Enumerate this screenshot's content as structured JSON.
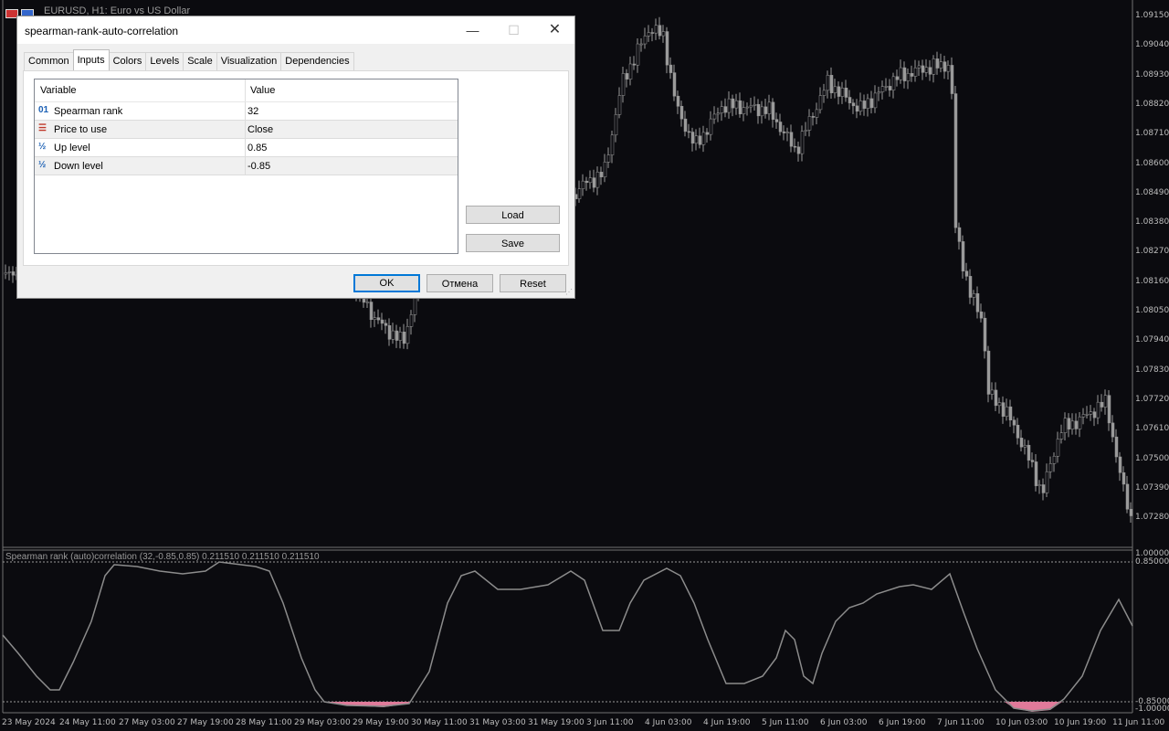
{
  "chart": {
    "title": "EURUSD, H1:  Euro vs US Dollar",
    "indicator_title": "Spearman rank (auto)correlation (32,-0.85,0.85) 0.211510 0.211510 0.211510",
    "price_labels": [
      "1.09150",
      "1.09040",
      "1.08930",
      "1.08820",
      "1.08710",
      "1.08600",
      "1.08490",
      "1.08380",
      "1.08270",
      "1.08160",
      "1.08050",
      "1.07940",
      "1.07830",
      "1.07720",
      "1.07610",
      "1.07500",
      "1.07390",
      "1.07280"
    ],
    "indicator_labels": [
      "1.000000",
      "0.850000",
      "-0.85000",
      "-1.00000"
    ],
    "time_labels": [
      "23 May 2024",
      "24 May 11:00",
      "27 May 03:00",
      "27 May 19:00",
      "28 May 11:00",
      "29 May 03:00",
      "29 May 19:00",
      "30 May 11:00",
      "31 May 03:00",
      "31 May 19:00",
      "3 Jun 11:00",
      "4 Jun 03:00",
      "4 Jun 19:00",
      "5 Jun 11:00",
      "6 Jun 03:00",
      "6 Jun 19:00",
      "7 Jun 11:00",
      "10 Jun 03:00",
      "10 Jun 19:00",
      "11 Jun 11:00"
    ],
    "colors": {
      "background": "#0b0b0f",
      "candle": "#9a9a9a",
      "line": "#8c8c8c",
      "fill": "#e07a9a",
      "axis": "#bdbdbd"
    }
  },
  "dialog": {
    "title": "spearman-rank-auto-correlation",
    "window_controls": {
      "minimize": "—",
      "maximize": "☐",
      "close": "✕"
    },
    "tabs": [
      "Common",
      "Inputs",
      "Colors",
      "Levels",
      "Scale",
      "Visualization",
      "Dependencies"
    ],
    "active_tab": "Inputs",
    "grid": {
      "headers": {
        "variable": "Variable",
        "value": "Value"
      },
      "rows": [
        {
          "icon": "01",
          "icon_name": "integer-icon",
          "name": "Spearman rank",
          "value": "32"
        },
        {
          "icon": "☰",
          "icon_name": "enum-icon",
          "name": "Price to use",
          "value": "Close"
        },
        {
          "icon": "½",
          "icon_name": "double-icon",
          "name": "Up level",
          "value": "0.85"
        },
        {
          "icon": "½",
          "icon_name": "double-icon",
          "name": "Down level",
          "value": "-0.85"
        }
      ]
    },
    "buttons": {
      "load": "Load",
      "save": "Save",
      "ok": "OK",
      "cancel": "Отмена",
      "reset": "Reset"
    }
  }
}
